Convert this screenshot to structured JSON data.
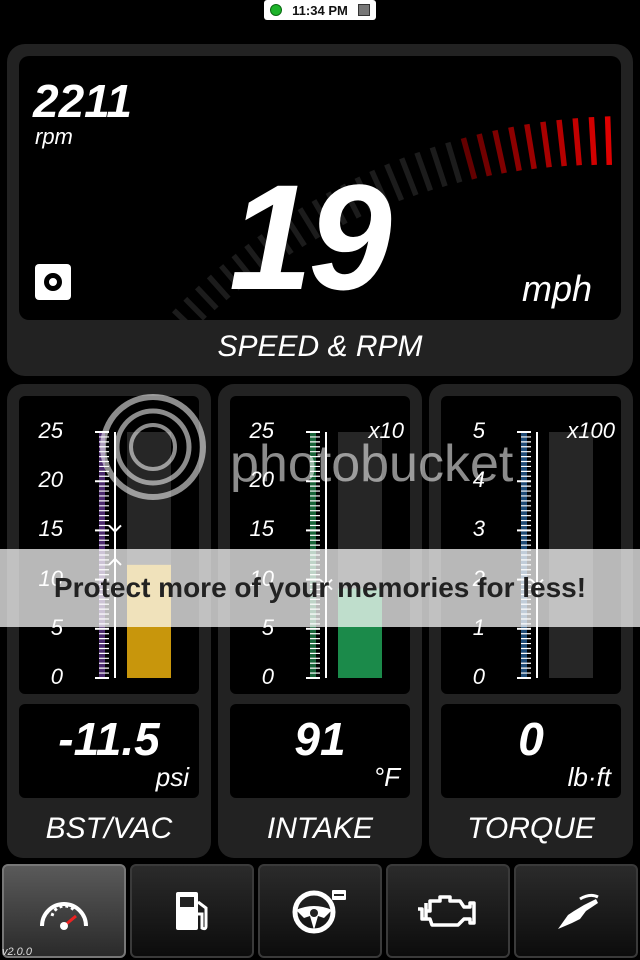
{
  "status_bar": {
    "time": "11:34 PM"
  },
  "speed_rpm": {
    "rpm_value": "2211",
    "rpm_unit": "rpm",
    "rpm_max": 8000,
    "speed_value": "19",
    "speed_unit": "mph",
    "title": "SPEED & RPM"
  },
  "gauges": [
    {
      "name": "BST/VAC",
      "value": "-11.5",
      "unit": "psi",
      "multiplier": "",
      "ticks": [
        "25",
        "20",
        "15",
        "10",
        "5",
        "0"
      ],
      "scale_max": 25,
      "bar_value": 11.5,
      "marker_upper": 15,
      "marker_lower": 12,
      "color": "#c8960c",
      "scale_color": "#8a4fc9"
    },
    {
      "name": "INTAKE",
      "value": "91",
      "unit": "°F",
      "multiplier": "x10",
      "ticks": [
        "25",
        "20",
        "15",
        "10",
        "5",
        "0"
      ],
      "scale_max": 25,
      "bar_value": 9.1,
      "marker_upper": 9.5,
      "marker_lower": 9.5,
      "color": "#1b8a4a",
      "scale_color": "#2fb86a"
    },
    {
      "name": "TORQUE",
      "value": "0",
      "unit": "lb·ft",
      "multiplier": "x100",
      "ticks": [
        "5",
        "4",
        "3",
        "2",
        "1",
        "0"
      ],
      "scale_max": 5,
      "bar_value": 0,
      "marker_upper": 1.9,
      "marker_lower": 1.9,
      "color": "#333333",
      "scale_color": "#3a8ad8"
    }
  ],
  "nav": [
    {
      "icon": "speedometer-icon",
      "active": true
    },
    {
      "icon": "fuel-pump-icon",
      "active": false
    },
    {
      "icon": "steering-wheel-icon",
      "active": false
    },
    {
      "icon": "check-engine-icon",
      "active": false
    },
    {
      "icon": "fuel-nozzle-icon",
      "active": false
    }
  ],
  "version": "v2.0.0",
  "watermark": {
    "logo_text": "photobucket",
    "banner": "Protect more of your memories for less!"
  }
}
